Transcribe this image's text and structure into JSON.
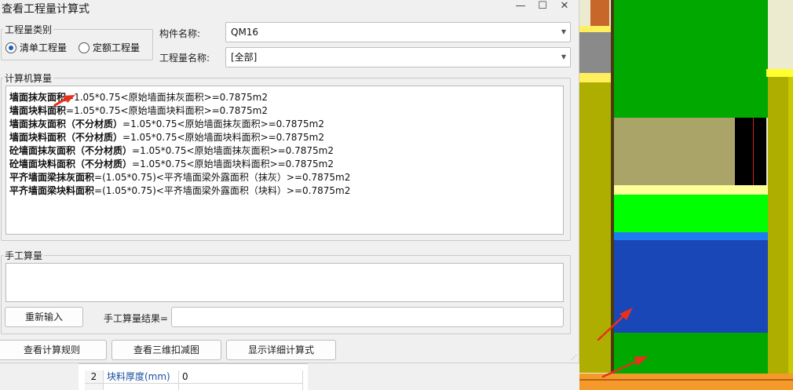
{
  "window": {
    "title": "查看工程量计算式",
    "min": "—",
    "max": "☐",
    "close": "✕"
  },
  "type_group": {
    "legend": "工程量类别",
    "option1": "清单工程量",
    "option2": "定额工程量",
    "selected": "option1"
  },
  "component": {
    "label": "构件名称:",
    "value": "QM16"
  },
  "quantity_name": {
    "label": "工程量名称:",
    "value": "[全部]"
  },
  "computer_calc": {
    "legend": "计算机算量",
    "lines": [
      {
        "name": "墙面抹灰面积",
        "formula": "=1.05*0.75<原始墙面抹灰面积>=0.7875m2"
      },
      {
        "name": "墙面块料面积",
        "formula": "=1.05*0.75<原始墙面块料面积>=0.7875m2"
      },
      {
        "name": "墙面抹灰面积（不分材质）",
        "formula": "=1.05*0.75<原始墙面抹灰面积>=0.7875m2"
      },
      {
        "name": "墙面块料面积（不分材质）",
        "formula": "=1.05*0.75<原始墙面块料面积>=0.7875m2"
      },
      {
        "name": "砼墙面抹灰面积（不分材质）",
        "formula": "=1.05*0.75<原始墙面抹灰面积>=0.7875m2"
      },
      {
        "name": "砼墙面块料面积（不分材质）",
        "formula": "=1.05*0.75<原始墙面块料面积>=0.7875m2"
      },
      {
        "name": "平齐墙面梁抹灰面积",
        "formula": "=(1.05*0.75)<平齐墙面梁外露面积（抹灰）>=0.7875m2"
      },
      {
        "name": "平齐墙面梁块料面积",
        "formula": "=(1.05*0.75)<平齐墙面梁外露面积（块料）>=0.7875m2"
      }
    ]
  },
  "manual_calc": {
    "legend": "手工算量",
    "reenter": "重新输入",
    "result_label": "手工算量结果="
  },
  "footer": {
    "view_rules": "查看计算规则",
    "view_3d": "查看三维扣减图",
    "show_detail": "显示详细计算式"
  },
  "prop_table": {
    "row1": {
      "index": "2",
      "name": "块料厚度(mm)",
      "value": "0"
    }
  },
  "colors": {
    "viewport_green": "#00a800",
    "viewport_bright_green": "#00ff00",
    "viewport_blue": "#1a47b8",
    "viewport_olive": "#b2b000",
    "viewport_yellow": "#ffff6a",
    "viewport_orange": "#f39a2a",
    "annotation_red": "#e8301c",
    "radio_selected": "#1a5cc8"
  }
}
